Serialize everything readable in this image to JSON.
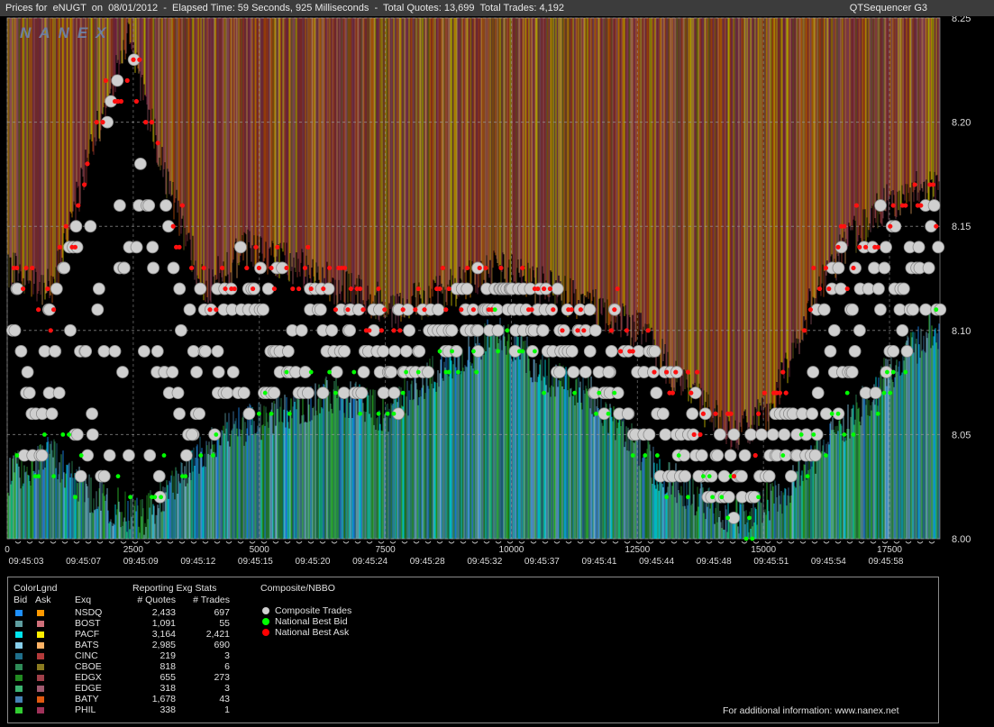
{
  "header": {
    "title": "Prices for  eNUGT  on  08/01/2012  -  Elapsed Time: 59 Seconds, 925 Milliseconds  -  Total Quotes: 13,699  Total Trades: 4,192",
    "product": "QTSequencer G3",
    "watermark": "NANEX"
  },
  "chart_data": {
    "type": "scatter",
    "title": "Prices for eNUGT on 08/01/2012",
    "ylim": [
      8.0,
      8.25
    ],
    "y_ticks": [
      "8.25",
      "8.20",
      "8.15",
      "8.10",
      "8.05",
      "8.00"
    ],
    "xlim": [
      0,
      18500
    ],
    "x_ticks": [
      "0",
      "2500",
      "5000",
      "7500",
      "10000",
      "12500",
      "15000",
      "17500"
    ],
    "time_labels": [
      "09:45:03",
      "09:45:07",
      "09:45:09",
      "09:45:12",
      "09:45:15",
      "09:45:20",
      "09:45:24",
      "09:45:28",
      "09:45:32",
      "09:45:37",
      "09:45:41",
      "09:45:44",
      "09:45:48",
      "09:45:51",
      "09:45:54",
      "09:45:58"
    ],
    "grid": true,
    "bid_anchors": [
      [
        0,
        8.03
      ],
      [
        900,
        8.04
      ],
      [
        1700,
        8.02
      ],
      [
        2700,
        8.01
      ],
      [
        3500,
        8.03
      ],
      [
        4200,
        8.05
      ],
      [
        5400,
        8.06
      ],
      [
        6500,
        8.07
      ],
      [
        7500,
        8.06
      ],
      [
        8500,
        8.08
      ],
      [
        9800,
        8.1
      ],
      [
        10600,
        8.08
      ],
      [
        11500,
        8.07
      ],
      [
        12300,
        8.05
      ],
      [
        13000,
        8.03
      ],
      [
        13700,
        8.02
      ],
      [
        14500,
        8.01
      ],
      [
        15300,
        8.02
      ],
      [
        16000,
        8.04
      ],
      [
        16800,
        8.06
      ],
      [
        17500,
        8.08
      ],
      [
        18300,
        8.1
      ]
    ],
    "ask_anchors": [
      [
        0,
        8.13
      ],
      [
        900,
        8.12
      ],
      [
        1700,
        8.19
      ],
      [
        2400,
        8.24
      ],
      [
        3200,
        8.17
      ],
      [
        3900,
        8.12
      ],
      [
        4800,
        8.14
      ],
      [
        5800,
        8.13
      ],
      [
        6700,
        8.12
      ],
      [
        7700,
        8.11
      ],
      [
        8800,
        8.12
      ],
      [
        9800,
        8.13
      ],
      [
        10700,
        8.12
      ],
      [
        11700,
        8.11
      ],
      [
        12600,
        8.1
      ],
      [
        13500,
        8.07
      ],
      [
        14400,
        8.05
      ],
      [
        15100,
        8.06
      ],
      [
        15900,
        8.11
      ],
      [
        16600,
        8.14
      ],
      [
        17400,
        8.16
      ],
      [
        18300,
        8.17
      ]
    ]
  },
  "legend": {
    "colorlgnd": "ColorLgnd",
    "bid_label": "Bid",
    "ask_label": "Ask",
    "exq_label": "Exq",
    "stats_title": "Reporting Exg Stats",
    "quotes_label": "# Quotes",
    "trades_label": "# Trades",
    "nbbo_title": "Composite/NBBO",
    "footer": "For additional information: www.nanex.net",
    "exchanges": [
      {
        "name": "NSDQ",
        "quotes": "2,433",
        "trades": "697",
        "bid_color": "#1e90ff",
        "ask_color": "#ff9900"
      },
      {
        "name": "BOST",
        "quotes": "1,091",
        "trades": "55",
        "bid_color": "#5f9ea0",
        "ask_color": "#d0707a"
      },
      {
        "name": "PACF",
        "quotes": "3,164",
        "trades": "2,421",
        "bid_color": "#00e5ee",
        "ask_color": "#ffee00"
      },
      {
        "name": "BATS",
        "quotes": "2,985",
        "trades": "690",
        "bid_color": "#87ceeb",
        "ask_color": "#ffb366"
      },
      {
        "name": "CINC",
        "quotes": "219",
        "trades": "3",
        "bid_color": "#1f6f8b",
        "ask_color": "#b33a3a"
      },
      {
        "name": "CBOE",
        "quotes": "818",
        "trades": "6",
        "bid_color": "#2e8b57",
        "ask_color": "#8a7a20"
      },
      {
        "name": "EDGX",
        "quotes": "655",
        "trades": "273",
        "bid_color": "#228b22",
        "ask_color": "#a0404a"
      },
      {
        "name": "EDGE",
        "quotes": "318",
        "trades": "3",
        "bid_color": "#3cb371",
        "ask_color": "#a05a70"
      },
      {
        "name": "BATY",
        "quotes": "1,678",
        "trades": "43",
        "bid_color": "#4682b4",
        "ask_color": "#e05a10"
      },
      {
        "name": "PHIL",
        "quotes": "338",
        "trades": "1",
        "bid_color": "#32cd32",
        "ask_color": "#a0325a"
      }
    ],
    "nbbo": [
      {
        "label": "Composite Trades",
        "color": "#d0d0d0"
      },
      {
        "label": "National Best Bid",
        "color": "#00ff00"
      },
      {
        "label": "National Best Ask",
        "color": "#ff0000"
      }
    ]
  }
}
